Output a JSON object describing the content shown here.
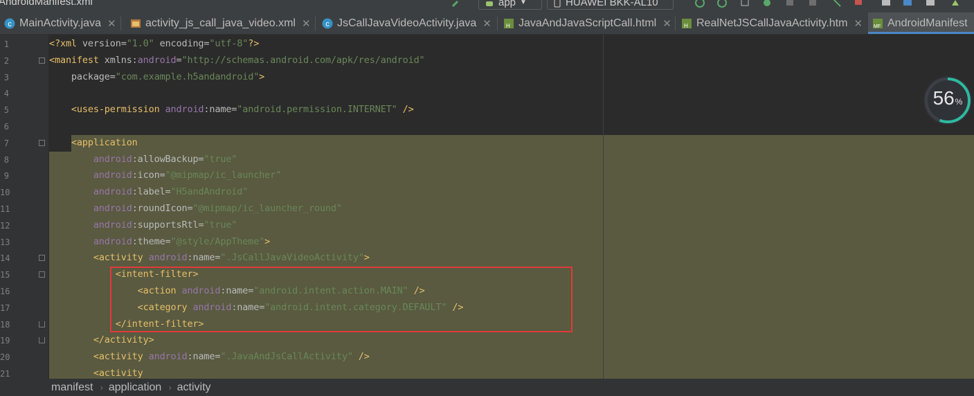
{
  "window": {
    "title": "AndroidManifest.xml"
  },
  "toolbar": {
    "run_config": "app",
    "device": "HUAWEI BKK-AL10"
  },
  "tabs": [
    {
      "label": "MainActivity.java",
      "icon": "java-class-icon"
    },
    {
      "label": "activity_js_call_java_video.xml",
      "icon": "xml-layout-icon"
    },
    {
      "label": "JsCallJavaVideoActivity.java",
      "icon": "java-class-icon"
    },
    {
      "label": "JavaAndJavaScriptCall.html",
      "icon": "html-file-icon"
    },
    {
      "label": "RealNetJSCallJavaActivity.htm",
      "icon": "html-file-icon"
    },
    {
      "label": "AndroidManifest",
      "icon": "manifest-file-icon",
      "active": true
    }
  ],
  "editor": {
    "line_numbers": [
      "1",
      "2",
      "3",
      "4",
      "5",
      "6",
      "7",
      "8",
      "9",
      "10",
      "11",
      "12",
      "13",
      "14",
      "15",
      "16",
      "17",
      "18",
      "19",
      "20",
      "21"
    ],
    "lines": [
      [
        [
          "br",
          "<?"
        ],
        [
          "tg",
          "xml"
        ],
        [
          "at",
          " version="
        ],
        [
          "vl",
          "\"1.0\""
        ],
        [
          "at",
          " encoding="
        ],
        [
          "vl",
          "\"utf-8\""
        ],
        [
          "br",
          "?>"
        ]
      ],
      [
        [
          "br",
          "<"
        ],
        [
          "tg",
          "manifest"
        ],
        [
          "at",
          " xmlns:"
        ],
        [
          "ns",
          "android"
        ],
        [
          "at",
          "="
        ],
        [
          "vl",
          "\"http://schemas.android.com/apk/res/android\""
        ]
      ],
      [
        [
          "pl",
          "    "
        ],
        [
          "at",
          "package="
        ],
        [
          "vl",
          "\"com.example.h5andandroid\""
        ],
        [
          "br",
          ">"
        ]
      ],
      [],
      [
        [
          "pl",
          "    "
        ],
        [
          "br",
          "<"
        ],
        [
          "tg",
          "uses-permission"
        ],
        [
          "at",
          " "
        ],
        [
          "ns",
          "android"
        ],
        [
          "at",
          ":name="
        ],
        [
          "vl",
          "\"android.permission.INTERNET\""
        ],
        [
          "br",
          " />"
        ]
      ],
      [],
      [
        [
          "pl",
          "    "
        ],
        [
          "br",
          "<"
        ],
        [
          "tg",
          "application"
        ]
      ],
      [
        [
          "pl",
          "        "
        ],
        [
          "ns",
          "android"
        ],
        [
          "at",
          ":allowBackup="
        ],
        [
          "vl",
          "\"true\""
        ]
      ],
      [
        [
          "pl",
          "        "
        ],
        [
          "ns",
          "android"
        ],
        [
          "at",
          ":icon="
        ],
        [
          "vl",
          "\"@mipmap/ic_launcher\""
        ]
      ],
      [
        [
          "pl",
          "        "
        ],
        [
          "ns",
          "android"
        ],
        [
          "at",
          ":label="
        ],
        [
          "vl",
          "\"H5andAndroid\""
        ]
      ],
      [
        [
          "pl",
          "        "
        ],
        [
          "ns",
          "android"
        ],
        [
          "at",
          ":roundIcon="
        ],
        [
          "vl",
          "\"@mipmap/ic_launcher_round\""
        ]
      ],
      [
        [
          "pl",
          "        "
        ],
        [
          "ns",
          "android"
        ],
        [
          "at",
          ":supportsRtl="
        ],
        [
          "vl",
          "\"true\""
        ]
      ],
      [
        [
          "pl",
          "        "
        ],
        [
          "ns",
          "android"
        ],
        [
          "at",
          ":theme="
        ],
        [
          "vl",
          "\"@style/AppTheme\""
        ],
        [
          "br",
          ">"
        ]
      ],
      [
        [
          "pl",
          "        "
        ],
        [
          "br",
          "<"
        ],
        [
          "tg",
          "activity"
        ],
        [
          "at",
          " "
        ],
        [
          "ns",
          "android"
        ],
        [
          "at",
          ":name="
        ],
        [
          "vl",
          "\".JsCallJavaVideoActivity\""
        ],
        [
          "br",
          ">"
        ]
      ],
      [
        [
          "pl",
          "            "
        ],
        [
          "br",
          "<"
        ],
        [
          "tg",
          "intent-filter"
        ],
        [
          "br",
          ">"
        ]
      ],
      [
        [
          "pl",
          "                "
        ],
        [
          "br",
          "<"
        ],
        [
          "tg",
          "action"
        ],
        [
          "at",
          " "
        ],
        [
          "ns",
          "android"
        ],
        [
          "at",
          ":name="
        ],
        [
          "vl",
          "\"android.intent.action.MAIN\""
        ],
        [
          "br",
          " />"
        ]
      ],
      [
        [
          "pl",
          "                "
        ],
        [
          "br",
          "<"
        ],
        [
          "tg",
          "category"
        ],
        [
          "at",
          " "
        ],
        [
          "ns",
          "android"
        ],
        [
          "at",
          ":name="
        ],
        [
          "vl",
          "\"android.intent.category.DEFAULT\""
        ],
        [
          "br",
          " />"
        ]
      ],
      [
        [
          "pl",
          "            "
        ],
        [
          "br",
          "</"
        ],
        [
          "tg",
          "intent-filter"
        ],
        [
          "br",
          ">"
        ]
      ],
      [
        [
          "pl",
          "        "
        ],
        [
          "br",
          "</"
        ],
        [
          "tg",
          "activity"
        ],
        [
          "br",
          ">"
        ]
      ],
      [
        [
          "pl",
          "        "
        ],
        [
          "br",
          "<"
        ],
        [
          "tg",
          "activity"
        ],
        [
          "at",
          " "
        ],
        [
          "ns",
          "android"
        ],
        [
          "at",
          ":name="
        ],
        [
          "vl",
          "\".JavaAndJsCallActivity\""
        ],
        [
          "br",
          " />"
        ]
      ],
      [
        [
          "pl",
          "        "
        ],
        [
          "br",
          "<"
        ],
        [
          "tg",
          "activity"
        ]
      ]
    ]
  },
  "progress_badge": {
    "value": "56",
    "unit": "%",
    "fraction": 0.56
  },
  "breadcrumb": [
    "manifest",
    "application",
    "activity"
  ],
  "colors": {
    "highlight": "#e03a3a",
    "selection": "#595a40",
    "tab_accent": "#4a88c7"
  }
}
